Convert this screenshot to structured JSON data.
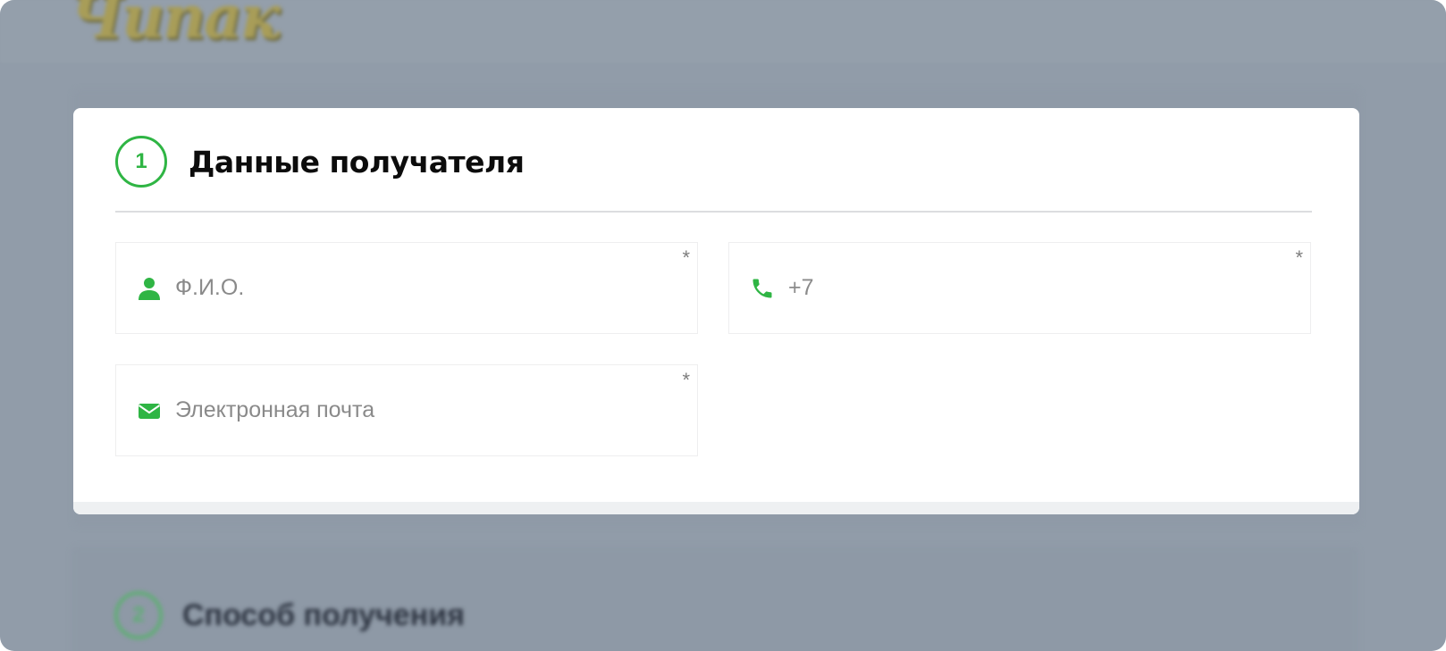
{
  "background": {
    "logo_text": "Чипак",
    "step2": {
      "number": "2",
      "title": "Способ получения"
    }
  },
  "step1": {
    "number": "1",
    "title": "Данные получателя"
  },
  "fields": {
    "name": {
      "placeholder": "Ф.И.О.",
      "required_mark": "*",
      "icon": "user-icon"
    },
    "phone": {
      "placeholder": "+7",
      "required_mark": "*",
      "icon": "phone-icon"
    },
    "email": {
      "placeholder": "Электронная почта",
      "required_mark": "*",
      "icon": "envelope-icon"
    }
  },
  "colors": {
    "accent": "#2fb544",
    "overlay": "#919ca9"
  }
}
